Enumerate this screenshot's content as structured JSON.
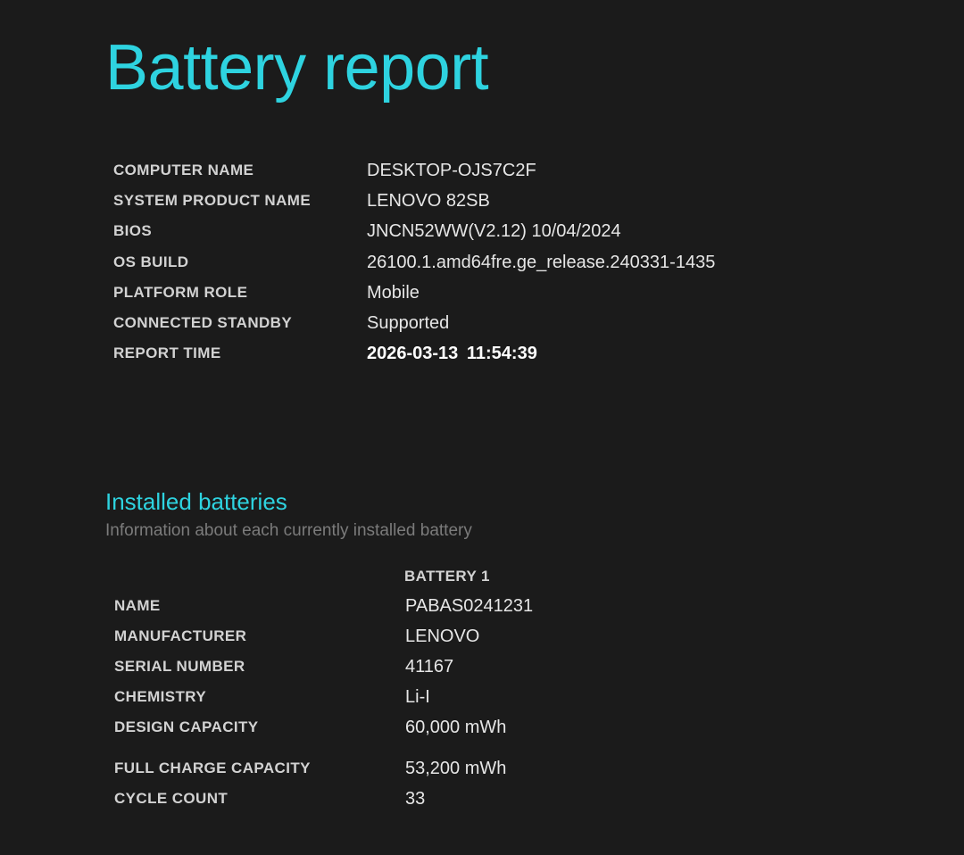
{
  "title": "Battery report",
  "system_info": [
    {
      "label": "COMPUTER NAME",
      "value": "DESKTOP-OJS7C2F"
    },
    {
      "label": "SYSTEM PRODUCT NAME",
      "value": "LENOVO 82SB"
    },
    {
      "label": "BIOS",
      "value": "JNCN52WW(V2.12) 10/04/2024"
    },
    {
      "label": "OS BUILD",
      "value": "26100.1.amd64fre.ge_release.240331-1435"
    },
    {
      "label": "PLATFORM ROLE",
      "value": "Mobile"
    },
    {
      "label": "CONNECTED STANDBY",
      "value": "Supported"
    },
    {
      "label": "REPORT TIME",
      "value": "2026-03-13  11:54:39"
    }
  ],
  "installed_batteries": {
    "title": "Installed batteries",
    "subtitle": "Information about each currently installed battery",
    "column_header": "BATTERY 1",
    "rows": [
      {
        "label": "NAME",
        "value": "PABAS0241231"
      },
      {
        "label": "MANUFACTURER",
        "value": "LENOVO"
      },
      {
        "label": "SERIAL NUMBER",
        "value": "41167"
      },
      {
        "label": "CHEMISTRY",
        "value": "Li-I"
      },
      {
        "label": "DESIGN CAPACITY",
        "value": "60,000 mWh"
      },
      {
        "label": "FULL CHARGE CAPACITY",
        "value": "53,200 mWh"
      },
      {
        "label": "CYCLE COUNT",
        "value": "33"
      }
    ]
  },
  "colors": {
    "background": "#1b1b1b",
    "accent": "#2ed3e0",
    "label": "#d2d2d2",
    "value": "#e6e6e6",
    "subtitle": "#7b7b7b"
  }
}
